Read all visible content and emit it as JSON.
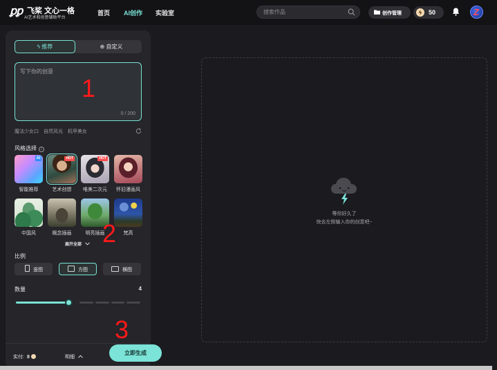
{
  "header": {
    "logo_mark": "飞桨",
    "logo_title": "飞桨 文心一格",
    "logo_sub": "AI艺术和创意辅助平台",
    "nav": [
      {
        "label": "首页",
        "active": false
      },
      {
        "label": "AI创作",
        "active": true
      },
      {
        "label": "实验室",
        "active": false
      }
    ],
    "search_placeholder": "搜索作品",
    "manage_label": "创作管理",
    "energy_value": "50",
    "avatar_letter": "Z"
  },
  "panel": {
    "tabs": [
      {
        "label": "ϟ 推荐",
        "active": true
      },
      {
        "label": "⊕ 自定义",
        "active": false
      }
    ],
    "prompt_placeholder": "写下你的创意",
    "prompt_count": "0 / 200",
    "annotation_1": "1",
    "annotation_2": "2",
    "annotation_3": "3",
    "suggestions": [
      "魔法少女口",
      "自然风光",
      "机甲美女"
    ],
    "style_label": "风格选择",
    "styles": [
      {
        "label": "智能推荐",
        "badge": "AI",
        "selected": false
      },
      {
        "label": "艺术创想",
        "badge": "HOT",
        "selected": true
      },
      {
        "label": "唯美二次元",
        "badge": "HOT",
        "selected": false
      },
      {
        "label": "怀旧漫画风",
        "badge": "",
        "selected": false
      },
      {
        "label": "中国风",
        "badge": "",
        "selected": false
      },
      {
        "label": "概念插画",
        "badge": "",
        "selected": false
      },
      {
        "label": "明亮插画",
        "badge": "",
        "selected": false
      },
      {
        "label": "梵高",
        "badge": "",
        "selected": false
      }
    ],
    "expand_label": "展开全部",
    "ratio_label": "比例",
    "ratios": [
      {
        "label": "竖图",
        "active": false
      },
      {
        "label": "方图",
        "active": true
      },
      {
        "label": "横图",
        "active": false
      }
    ],
    "quantity_label": "数量",
    "quantity_value": "4",
    "quantity_level": 4,
    "quantity_max": 9,
    "points_label": "实付:",
    "points_value": "8",
    "detail_label": "明细",
    "generate_label": "立即生成"
  },
  "canvas": {
    "empty_line1": "等你好久了",
    "empty_line2": "快去左侧输入你的创意吧~"
  }
}
